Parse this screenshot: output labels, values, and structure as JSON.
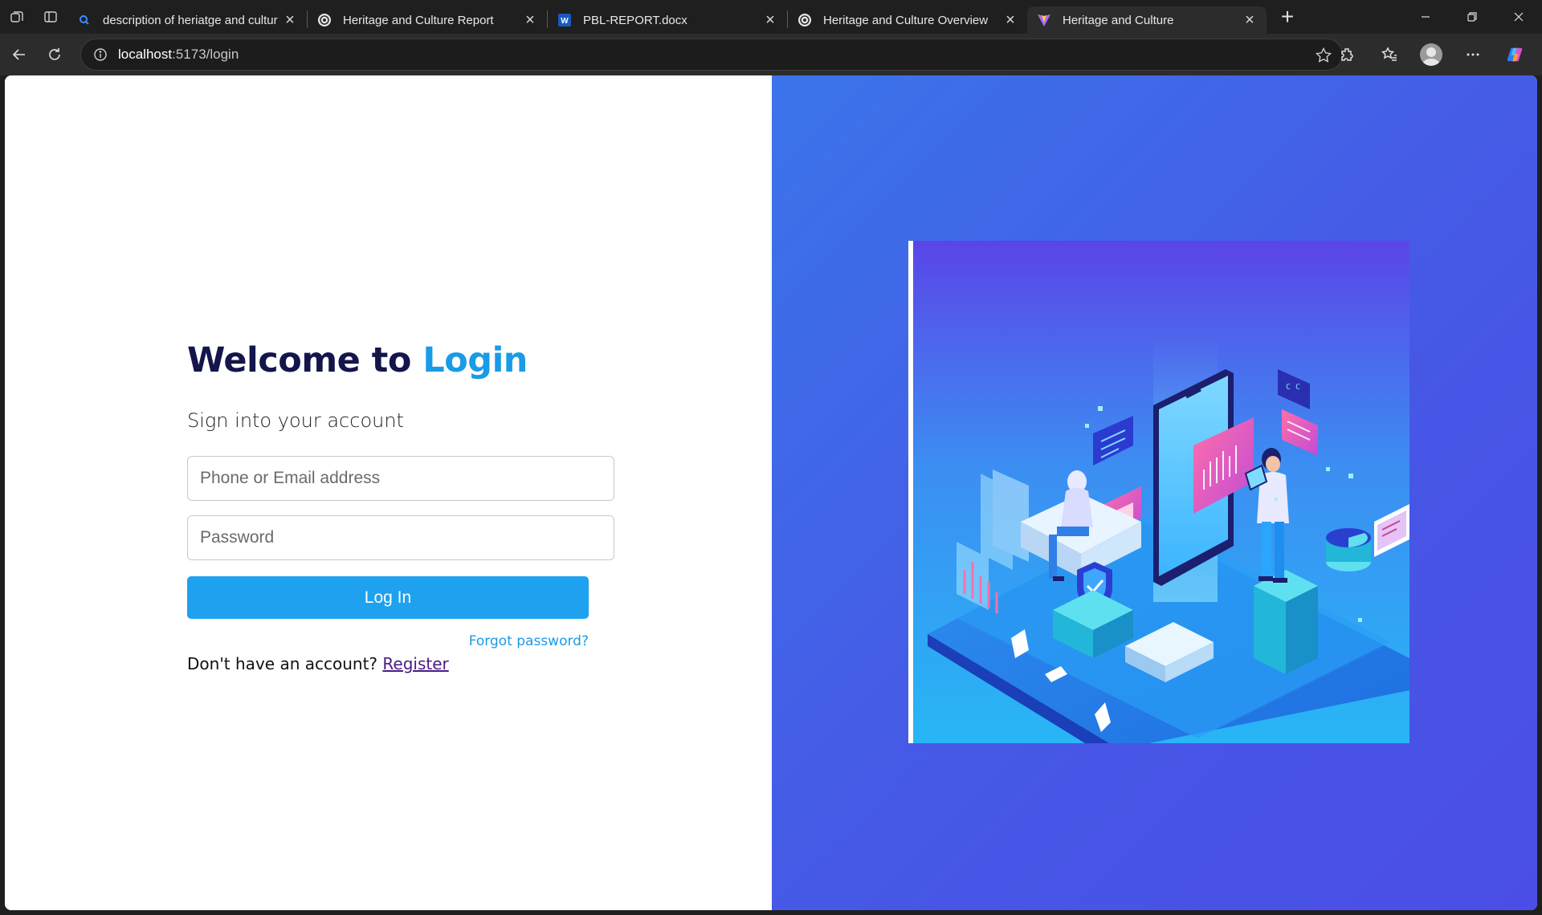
{
  "browser": {
    "tabs": [
      {
        "title": "description of heriatge and cultur",
        "favicon": "search-icon",
        "active": false
      },
      {
        "title": "Heritage and Culture Report",
        "favicon": "openai-icon",
        "active": false
      },
      {
        "title": "PBL-REPORT.docx",
        "favicon": "word-icon",
        "active": false
      },
      {
        "title": "Heritage and Culture Overview",
        "favicon": "openai-icon",
        "active": false
      },
      {
        "title": "Heritage and Culture",
        "favicon": "vite-icon",
        "active": true
      }
    ],
    "url_host": "localhost",
    "url_path": ":5173/login"
  },
  "login": {
    "title_prefix": "Welcome to ",
    "title_accent": "Login",
    "subtitle": "Sign into your account",
    "email_placeholder": "Phone or Email address",
    "password_placeholder": "Password",
    "login_label": "Log In",
    "forgot_label": "Forgot password?",
    "register_prompt": "Don't have an account? ",
    "register_label": "Register"
  },
  "colors": {
    "accent": "#1a9be6",
    "title_dark": "#13154b",
    "button": "#1ea1ee",
    "panel_gradient_start": "#3b74ea",
    "panel_gradient_end": "#4b4ee6"
  }
}
